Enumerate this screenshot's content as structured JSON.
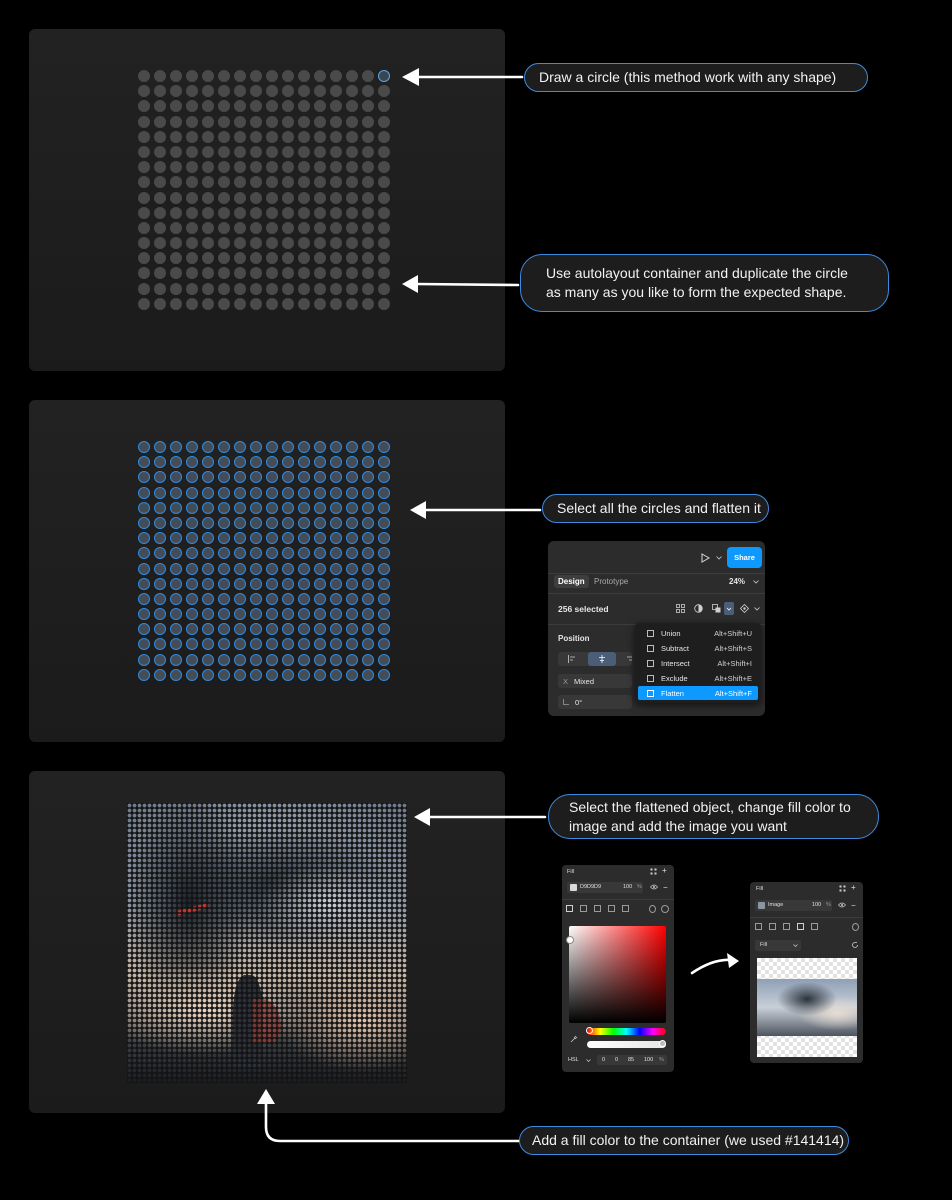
{
  "callouts": {
    "step1": "Draw a circle (this method work with any shape)",
    "step2": "Use autolayout container and duplicate the circle as many as you like to form the expected shape.",
    "step3": "Select all the circles and flatten it",
    "step4": "Select the flattened object, change fill color to image and add the image you want",
    "step5": "Add a fill color to the container (we used #141414)"
  },
  "grid": {
    "rows": 16,
    "columns": 16
  },
  "colors": {
    "accent": "#3d8be0",
    "selection": "#2f8ae0",
    "share": "#0d99ff",
    "container_fill": "#141414"
  },
  "design_panel": {
    "share_label": "Share",
    "tabs": [
      {
        "label": "Design",
        "active": true
      },
      {
        "label": "Prototype",
        "active": false
      }
    ],
    "zoom": "24%",
    "selected_count": "256 selected",
    "position_label": "Position",
    "x_label": "X",
    "x_value": "Mixed",
    "rotation_value": "0°",
    "menu": [
      {
        "label": "Union",
        "shortcut": "Alt+Shift+U",
        "icon": "union-icon"
      },
      {
        "label": "Subtract",
        "shortcut": "Alt+Shift+S",
        "icon": "subtract-icon"
      },
      {
        "label": "Intersect",
        "shortcut": "Alt+Shift+I",
        "icon": "intersect-icon"
      },
      {
        "label": "Exclude",
        "shortcut": "Alt+Shift+E",
        "icon": "exclude-icon"
      },
      {
        "label": "Flatten",
        "shortcut": "Alt+Shift+F",
        "icon": "flatten-icon",
        "active": true
      }
    ]
  },
  "fill_panel_color": {
    "title": "Fill",
    "hex": "D9D9D9",
    "opacity": "100",
    "percent": "%",
    "mode": "HSL",
    "values": [
      "0",
      "0",
      "85",
      "100"
    ]
  },
  "fill_panel_image": {
    "title": "Fill",
    "type": "Image",
    "opacity": "100",
    "percent": "%",
    "fit_mode": "Fill"
  }
}
